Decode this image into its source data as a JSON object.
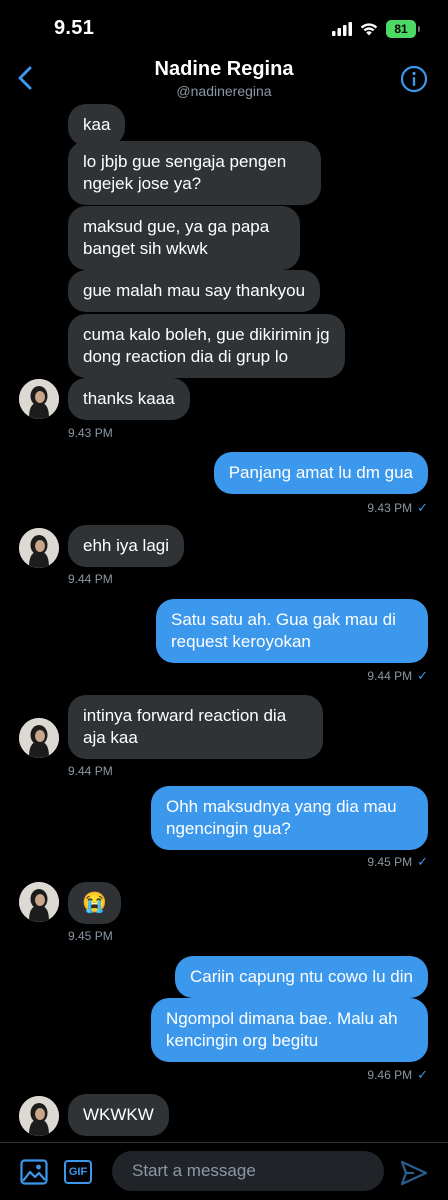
{
  "status": {
    "time": "9.51",
    "battery": "81"
  },
  "header": {
    "name": "Nadine Regina",
    "handle": "@nadineregina"
  },
  "messages": [
    {
      "text": "kaa"
    },
    {
      "text": "lo jbjb gue sengaja pengen ngejek jose ya?"
    },
    {
      "text": "maksud gue, ya ga papa banget sih wkwk"
    },
    {
      "text": "gue malah mau say thankyou"
    },
    {
      "text": "cuma kalo boleh, gue dikirimin jg dong reaction dia di grup lo"
    },
    {
      "text": "thanks kaaa",
      "time": "9.43 PM"
    },
    {
      "text": "Panjang amat lu dm gua",
      "time": "9.43 PM"
    },
    {
      "text": "ehh iya lagi",
      "time": "9.44 PM"
    },
    {
      "text": "Satu satu ah. Gua gak mau di request keroyokan",
      "time": "9.44 PM"
    },
    {
      "text": "intinya forward reaction dia aja kaa",
      "time": "9.44 PM"
    },
    {
      "text": "Ohh maksudnya yang dia mau ngencingin gua?",
      "time": "9.45 PM"
    },
    {
      "text": "😭",
      "time": "9.45 PM"
    },
    {
      "text": "Cariin capung ntu cowo lu din"
    },
    {
      "text": "Ngompol dimana bae. Malu ah kencingin org begitu",
      "time": "9.46 PM"
    },
    {
      "text": "WKWKW"
    }
  ],
  "compose": {
    "placeholder": "Start a message",
    "gif_label": "GIF"
  },
  "colors": {
    "accent": "#3c98ed",
    "incoming": "#2f3336",
    "background": "#000000"
  }
}
